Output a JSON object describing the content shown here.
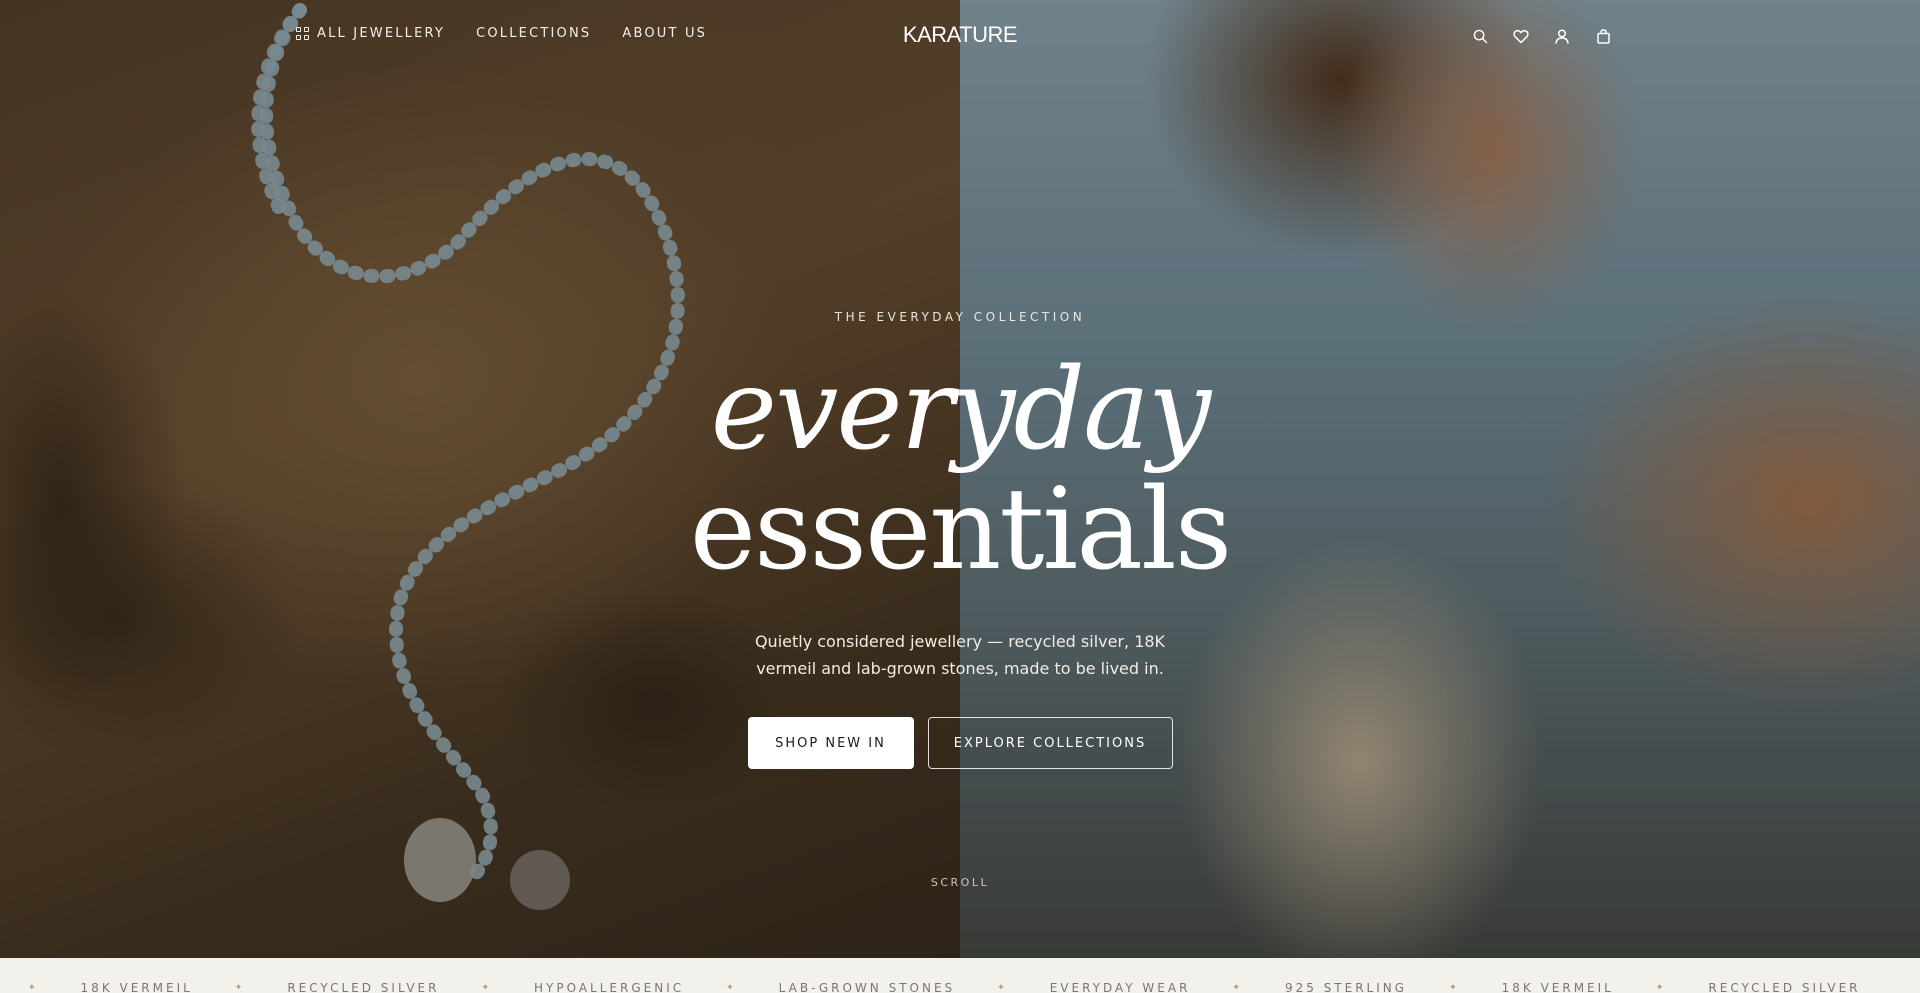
{
  "nav": {
    "all_jewellery": "ALL JEWELLERY",
    "collections": "COLLECTIONS",
    "about_us": "ABOUT US"
  },
  "brand": {
    "logo": "KARATURE"
  },
  "icons": {
    "search": "search-icon",
    "wishlist": "heart-icon",
    "account": "user-icon",
    "bag": "shopping-bag-icon",
    "menu": "grid-icon"
  },
  "hero": {
    "eyebrow": "THE EVERYDAY COLLECTION",
    "headline_line1": "everyday",
    "headline_line2": "essentials",
    "subcopy": "Quietly considered jewellery — recycled silver, 18K vermeil and lab-grown stones, made to be lived in.",
    "primary_cta": "SHOP NEW IN",
    "secondary_cta": "EXPLORE COLLECTIONS",
    "scroll_label": "SCROLL"
  },
  "ticker": {
    "items": [
      "18K VERMEIL",
      "RECYCLED SILVER",
      "HYPOALLERGENIC",
      "LAB-GROWN STONES",
      "EVERYDAY WEAR",
      "925 STERLING",
      "18K VERMEIL",
      "RECYCLED SILVER"
    ],
    "separator": "✦"
  },
  "colors": {
    "accent": "#b29a6a",
    "ticker_bg": "#f3f1ec",
    "text_light": "#ffffff"
  }
}
